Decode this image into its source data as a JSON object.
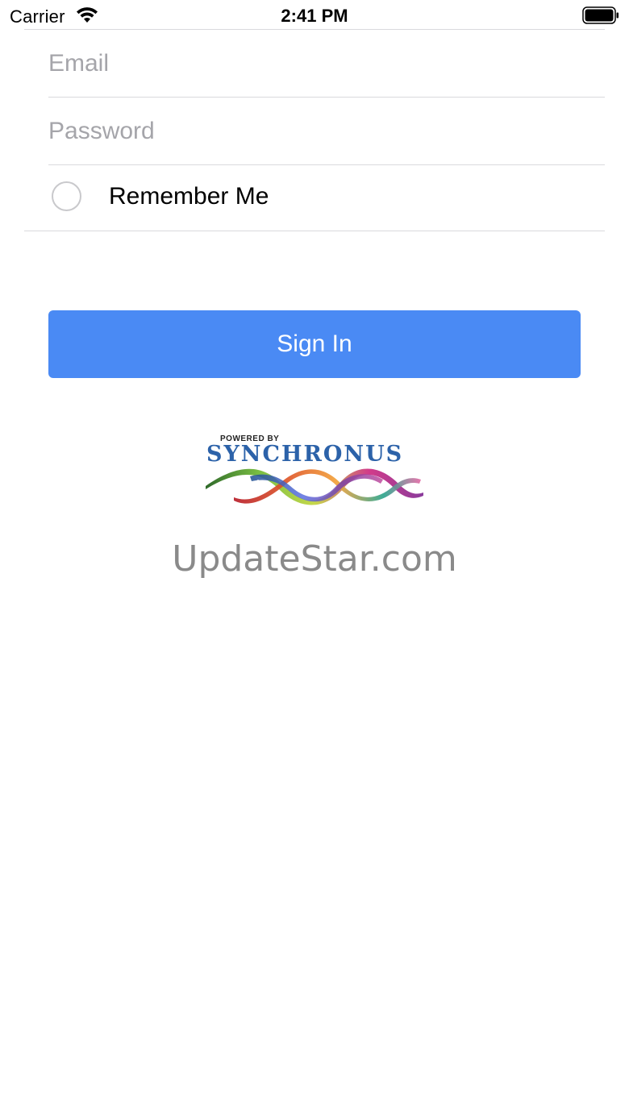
{
  "status_bar": {
    "carrier": "Carrier",
    "time": "2:41 PM",
    "wifi_icon": "wifi-icon",
    "battery_icon": "battery-full-icon"
  },
  "form": {
    "email": {
      "placeholder": "Email",
      "value": ""
    },
    "password": {
      "placeholder": "Password",
      "value": ""
    },
    "remember_me": {
      "label": "Remember Me",
      "checked": false
    }
  },
  "sign_in": {
    "label": "Sign In"
  },
  "logo": {
    "powered_by": "POWERED BY",
    "name": "SYNCHRONUS"
  },
  "watermark": "UpdateStar.com",
  "colors": {
    "primary_button": "#4a8af4",
    "separator": "#d9d9dd",
    "placeholder": "#a5a5aa",
    "logo_text": "#2c62a9"
  }
}
